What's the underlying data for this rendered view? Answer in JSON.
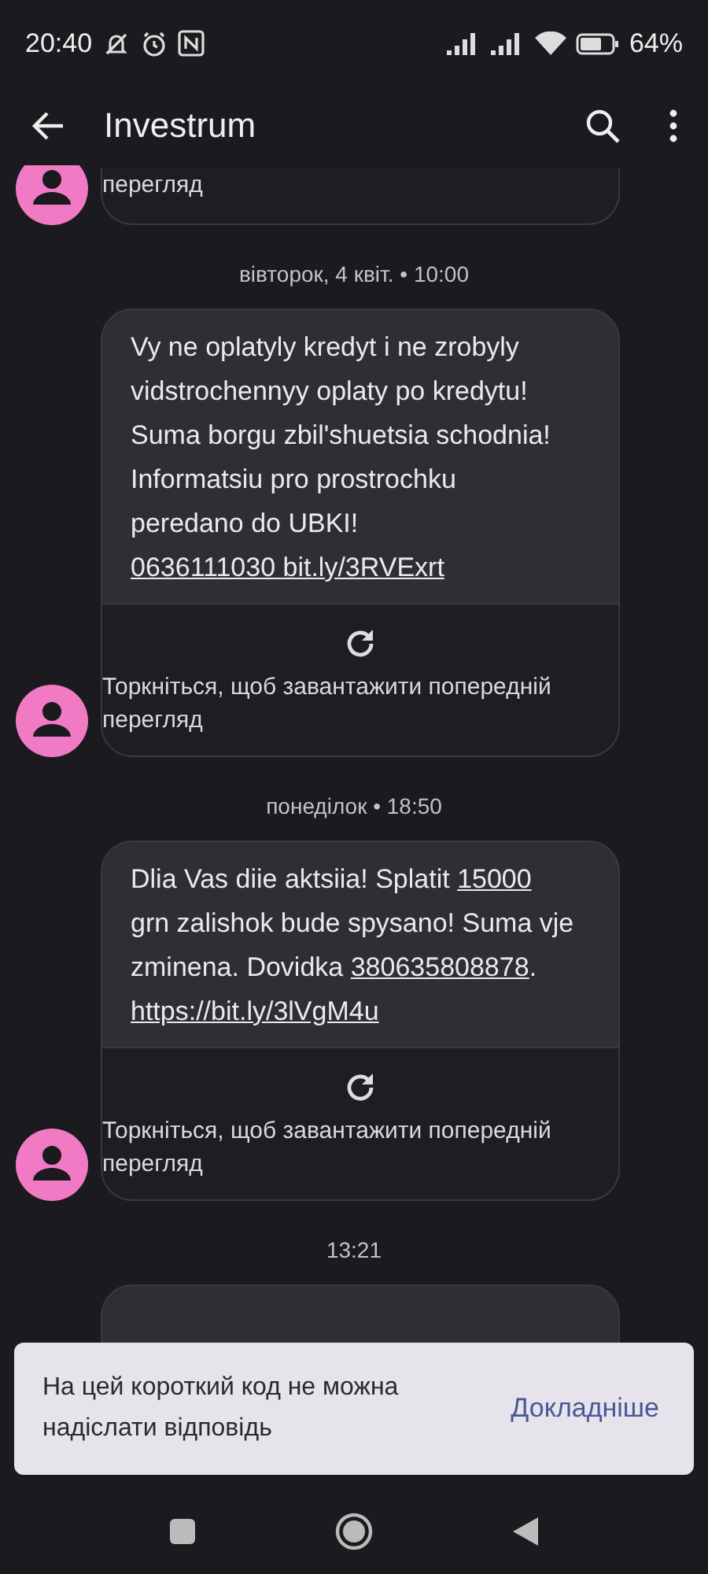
{
  "status_bar": {
    "time": "20:40",
    "battery": "64%"
  },
  "app_bar": {
    "title": "Investrum"
  },
  "messages": [
    {
      "kind": "partial",
      "preview_caption": "перегляд"
    },
    {
      "kind": "full",
      "timestamp": "вівторок, 4 квіт. • 10:00",
      "body": [
        {
          "text": "Vy ne oplatyly kredyt i ne zrobyly vidstrochennyy oplaty po kredytu! Suma borgu zbil'shuetsia schodnia! Informatsiu pro prostrochku peredano do UBKI! ",
          "link": false
        },
        {
          "text": "0636111030",
          "link": true
        },
        {
          "text": " bit.ly/3RVExrt",
          "link": true
        }
      ],
      "preview_caption": "Торкніться, щоб завантажити попередній перегляд"
    },
    {
      "kind": "full",
      "timestamp": "понеділок • 18:50",
      "body": [
        {
          "text": "Dlia Vas diie aktsiia! Splatit ",
          "link": false
        },
        {
          "text": "15000",
          "link": true
        },
        {
          "text": " grn zalishok bude spysano! Suma vje zminena. Dovidka ",
          "link": false
        },
        {
          "text": "380635808878",
          "link": true
        },
        {
          "text": ". ",
          "link": false
        },
        {
          "text": "https://bit.ly/3lVgM4u",
          "link": true
        }
      ],
      "preview_caption": "Торкніться, щоб завантажити попередній перегляд"
    },
    {
      "kind": "cut",
      "timestamp": "13:21"
    }
  ],
  "snackbar": {
    "message": "На цей короткий код не можна надіслати відповідь",
    "action": "Докладніше"
  }
}
